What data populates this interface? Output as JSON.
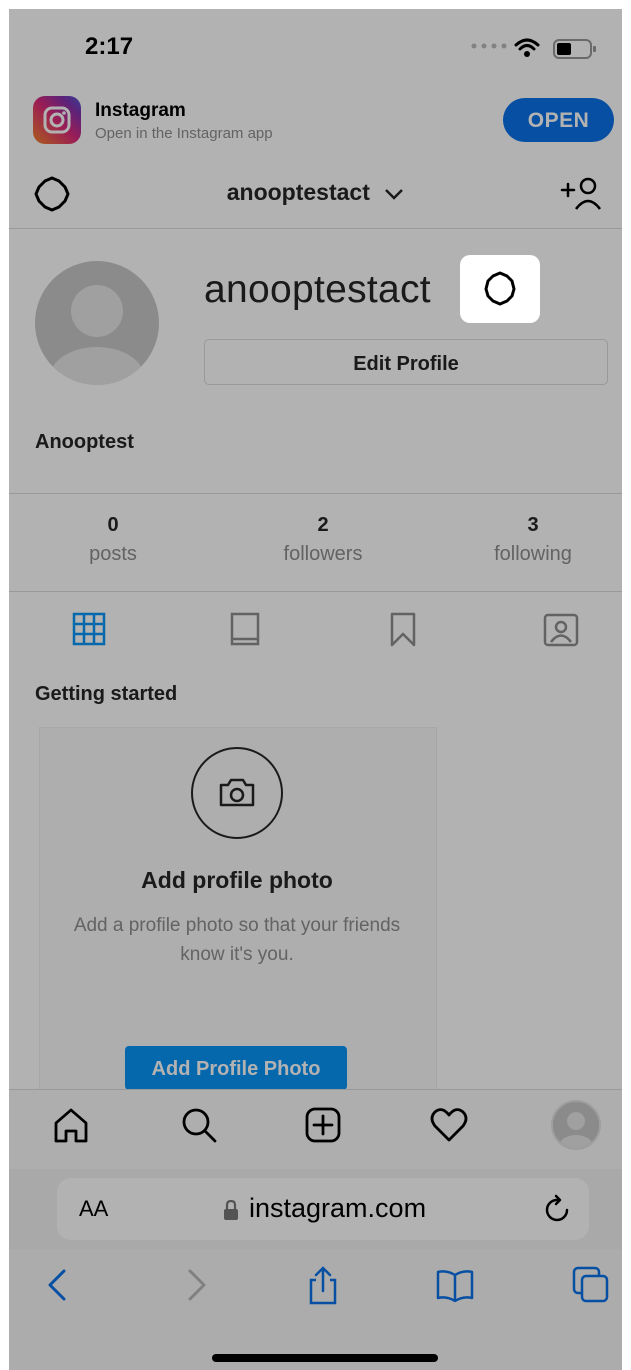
{
  "status_bar": {
    "time": "2:17"
  },
  "app_banner": {
    "app_name": "Instagram",
    "subtitle": "Open in the Instagram app",
    "open_label": "OPEN"
  },
  "header": {
    "username": "anooptestact"
  },
  "profile": {
    "username": "anooptestact",
    "edit_label": "Edit Profile",
    "display_name": "Anooptest"
  },
  "stats": [
    {
      "value": "0",
      "label": "posts"
    },
    {
      "value": "2",
      "label": "followers"
    },
    {
      "value": "3",
      "label": "following"
    }
  ],
  "getting_started": {
    "title": "Getting started",
    "card_title": "Add profile photo",
    "card_text": "Add a profile photo so that your friends know it's you.",
    "card_button": "Add Profile Photo"
  },
  "url_bar": {
    "aa_label": "AA",
    "domain": "instagram.com"
  },
  "colors": {
    "accent": "#0a95f6",
    "open_button": "#0a72e8",
    "overlay": "rgba(0,0,0,0.30)"
  }
}
